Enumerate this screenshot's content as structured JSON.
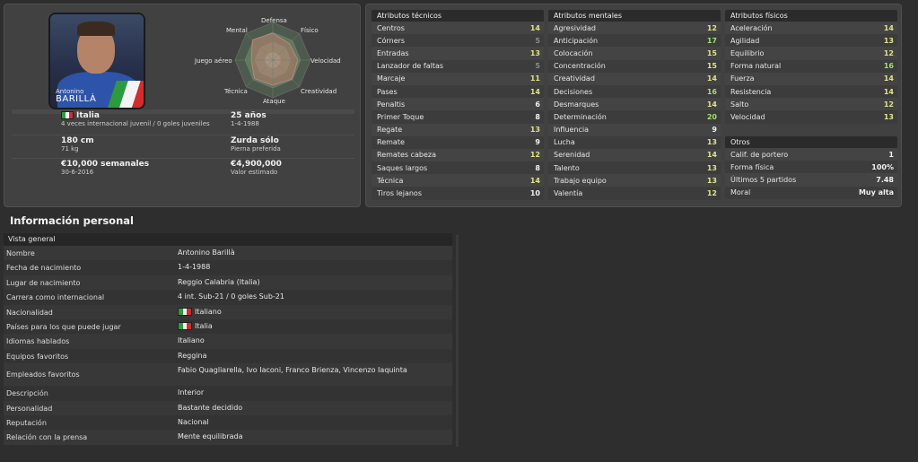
{
  "player": {
    "first_name": "Antonino",
    "last_name": "BARILLÀ",
    "nationality": "Italia",
    "intl_record": "4 veces internacional juvenil / 0 goles juveniles",
    "age": "25 años",
    "dob": "1-4-1988",
    "height": "180 cm",
    "weight": "71 kg",
    "foot": "Zurda sólo",
    "foot_sub": "Pierna preferida",
    "wage": "€10,000 semanales",
    "contract": "30-6-2016",
    "value": "€4,900,000",
    "value_sub": "Valor estimado"
  },
  "radar": {
    "labels": {
      "defensa": "Defensa",
      "fisico": "Físico",
      "velocidad": "Velocidad",
      "creatividad": "Creatividad",
      "ataque": "Ataque",
      "tecnica": "Técnica",
      "juego_aereo": "Juego aéreo",
      "mental": "Mental"
    }
  },
  "colors": {
    "italy_green": "#2e9a3f",
    "italy_white": "#f4f4f4",
    "italy_red": "#d12d2d",
    "attr_green": "#9fe06b",
    "attr_yellow": "#e2e288",
    "attr_white": "#f0f0f0",
    "attr_grey": "#8c8c8c"
  },
  "attributes": {
    "tecnicos": {
      "title": "Atributos técnicos",
      "rows": [
        {
          "name": "Centros",
          "value": "14",
          "tone": "yellow"
        },
        {
          "name": "Córners",
          "value": "5",
          "tone": "grey"
        },
        {
          "name": "Entradas",
          "value": "13",
          "tone": "yellow"
        },
        {
          "name": "Lanzador de faltas",
          "value": "5",
          "tone": "grey"
        },
        {
          "name": "Marcaje",
          "value": "11",
          "tone": "yellow"
        },
        {
          "name": "Pases",
          "value": "14",
          "tone": "yellow"
        },
        {
          "name": "Penaltis",
          "value": "6",
          "tone": "white"
        },
        {
          "name": "Primer Toque",
          "value": "8",
          "tone": "white"
        },
        {
          "name": "Regate",
          "value": "13",
          "tone": "yellow"
        },
        {
          "name": "Remate",
          "value": "9",
          "tone": "white"
        },
        {
          "name": "Remates cabeza",
          "value": "12",
          "tone": "yellow"
        },
        {
          "name": "Saques largos",
          "value": "8",
          "tone": "white"
        },
        {
          "name": "Técnica",
          "value": "14",
          "tone": "yellow"
        },
        {
          "name": "Tiros lejanos",
          "value": "10",
          "tone": "white"
        }
      ]
    },
    "mentales": {
      "title": "Atributos mentales",
      "rows": [
        {
          "name": "Agresividad",
          "value": "12",
          "tone": "yellow"
        },
        {
          "name": "Anticipación",
          "value": "17",
          "tone": "green"
        },
        {
          "name": "Colocación",
          "value": "15",
          "tone": "yellow"
        },
        {
          "name": "Concentración",
          "value": "15",
          "tone": "yellow"
        },
        {
          "name": "Creatividad",
          "value": "14",
          "tone": "yellow"
        },
        {
          "name": "Decisiones",
          "value": "16",
          "tone": "green"
        },
        {
          "name": "Desmarques",
          "value": "14",
          "tone": "yellow"
        },
        {
          "name": "Determinación",
          "value": "20",
          "tone": "green"
        },
        {
          "name": "Influencia",
          "value": "9",
          "tone": "white"
        },
        {
          "name": "Lucha",
          "value": "13",
          "tone": "yellow"
        },
        {
          "name": "Serenidad",
          "value": "14",
          "tone": "yellow"
        },
        {
          "name": "Talento",
          "value": "13",
          "tone": "yellow"
        },
        {
          "name": "Trabajo equipo",
          "value": "13",
          "tone": "yellow"
        },
        {
          "name": "Valentía",
          "value": "12",
          "tone": "yellow"
        }
      ]
    },
    "fisicos": {
      "title": "Atributos físicos",
      "rows": [
        {
          "name": "Aceleración",
          "value": "14",
          "tone": "yellow"
        },
        {
          "name": "Agilidad",
          "value": "13",
          "tone": "yellow"
        },
        {
          "name": "Equilibrio",
          "value": "12",
          "tone": "yellow"
        },
        {
          "name": "Forma natural",
          "value": "16",
          "tone": "green"
        },
        {
          "name": "Fuerza",
          "value": "14",
          "tone": "yellow"
        },
        {
          "name": "Resistencia",
          "value": "14",
          "tone": "yellow"
        },
        {
          "name": "Salto",
          "value": "12",
          "tone": "yellow"
        },
        {
          "name": "Velocidad",
          "value": "13",
          "tone": "yellow"
        }
      ]
    },
    "otros": {
      "title": "Otros",
      "rows": [
        {
          "name": "Calif. de portero",
          "value": "1"
        },
        {
          "name": "Forma física",
          "value": "100%"
        },
        {
          "name": "Últimos 5 partidos",
          "value": "7.48"
        },
        {
          "name": "Moral",
          "value": "Muy alta"
        }
      ]
    }
  },
  "personal": {
    "title": "Información personal",
    "header": "Vista general",
    "rows": [
      {
        "label": "Nombre",
        "value": "Antonino Barillà"
      },
      {
        "label": "Fecha de nacimiento",
        "value": "1-4-1988"
      },
      {
        "label": "Lugar de nacimiento",
        "value": "Reggio Calabria (Italia)"
      },
      {
        "label": "Carrera como internacional",
        "value": "4 int. Sub-21 / 0 goles Sub-21"
      },
      {
        "label": "Nacionalidad",
        "value": "Italiano",
        "flag": true
      },
      {
        "label": "Países para los que puede jugar",
        "value": "Italia",
        "flag": true
      },
      {
        "label": "Idiomas hablados",
        "value": "Italiano"
      },
      {
        "label": "Equipos favoritos",
        "value": "Reggina"
      },
      {
        "label": "Empleados favoritos",
        "value": "Fabio Quagliarella, Ivo Iaconi, Franco Brienza, Vincenzo Iaquinta"
      },
      {
        "label": "Descripción",
        "value": "Interior"
      },
      {
        "label": "Personalidad",
        "value": "Bastante decidido"
      },
      {
        "label": "Reputación",
        "value": "Nacional"
      },
      {
        "label": "Relación con la prensa",
        "value": "Mente equilibrada"
      }
    ]
  }
}
